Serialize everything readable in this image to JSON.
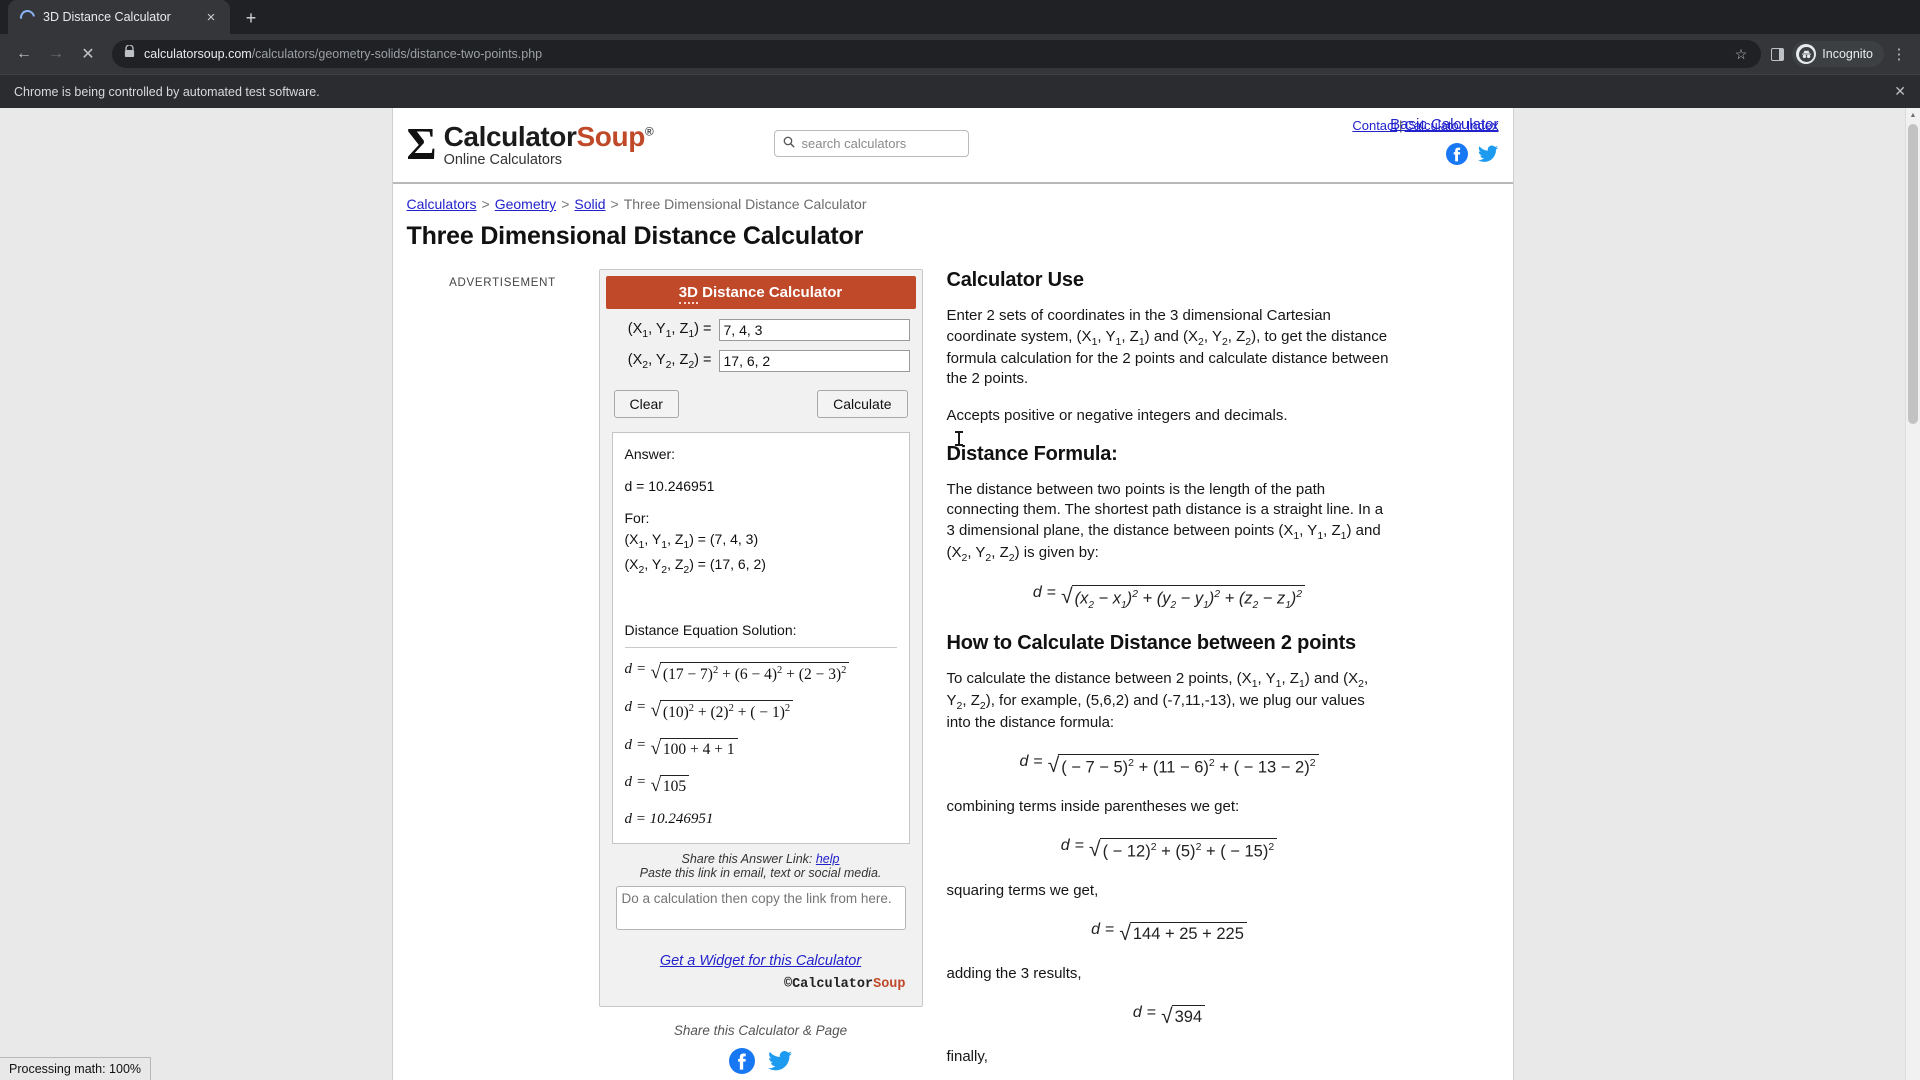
{
  "browser": {
    "tab_title": "3D Distance Calculator",
    "tab_close": "×",
    "new_tab": "+",
    "back_icon": "←",
    "forward_icon": "→",
    "stop_icon": "✕",
    "url_domain": "calculatorsoup.com",
    "url_path": "/calculators/geometry-solids/distance-two-points.php",
    "star_icon": "☆",
    "profile_label": "Incognito",
    "menu_icon": "⋮",
    "infobar_text": "Chrome is being controlled by automated test software.",
    "infobar_close": "✕"
  },
  "status": {
    "processing": "Processing math: 100%"
  },
  "site": {
    "logo_sigma": "Σ",
    "brand_first": "Calculator",
    "brand_second": "Soup",
    "brand_reg": "®",
    "tagline": "Online Calculators",
    "search_placeholder": "search calculators",
    "search_value": "",
    "top_links": {
      "contact": "Contact",
      "divider": "|",
      "index": "Calculator Index"
    },
    "social": {
      "facebook": "facebook-icon",
      "twitter": "twitter-icon"
    }
  },
  "breadcrumb": {
    "items": [
      "Calculators",
      "Geometry",
      "Solid"
    ],
    "current": "Three Dimensional Distance Calculator",
    "separator": ">"
  },
  "basic_calculator_link": "Basic Calculator",
  "page_title": "Three Dimensional Distance Calculator",
  "advertisement_label": "ADVERTISEMENT",
  "calculator": {
    "title_prefix": "3D",
    "title_rest": " Distance Calculator",
    "field1": {
      "label_open": "(X",
      "sub1": "1",
      "mid1": ", Y",
      "sub2": "1",
      "mid2": ", Z",
      "sub3": "1",
      "close": ") = ",
      "value": "7, 4, 3"
    },
    "field2": {
      "label_open": "(X",
      "sub1": "2",
      "mid1": ", Y",
      "sub2": "2",
      "mid2": ", Z",
      "sub3": "2",
      "close": ") = ",
      "value": "17, 6, 2"
    },
    "clear_label": "Clear",
    "calculate_label": "Calculate",
    "answer": {
      "heading": "Answer:",
      "result": "d = 10.246951",
      "for_label": "For:",
      "point1": "(X1, Y1, Z1) = (7, 4, 3)",
      "point2": "(X2, Y2, Z2) = (17, 6, 2)",
      "solution_heading": "Distance Equation Solution:",
      "steps": [
        "d = √((17 − 7)² + (6 − 4)² + (2 − 3)²)",
        "d = √((10)² + (2)² + ( − 1)²)",
        "d = √(100 + 4 + 1)",
        "d = √105",
        "d = 10.246951"
      ],
      "step1_radicand": "(17 − 7)² + (6 − 4)² + (2 − 3)²",
      "step2_radicand": "(10)² + (2)² + ( − 1)²",
      "step3_radicand": "100 + 4 + 1",
      "step4_radicand": "105",
      "step5_plain": "d = 10.246951"
    },
    "share": {
      "line1_text": "Share this Answer Link: ",
      "line1_link": "help",
      "line2": "Paste this link in email, text or social media.",
      "textarea_placeholder": "Do a calculation then copy the link from here.",
      "textarea_value": ""
    },
    "widget_link": "Get a Widget for this Calculator",
    "footer_c": "©",
    "footer_brand1": "Calculator",
    "footer_brand2": "Soup"
  },
  "share_page": {
    "label": "Share this Calculator & Page"
  },
  "content": {
    "h_calculator_use": "Calculator Use",
    "p1_a": "Enter 2 sets of coordinates in the 3 dimensional Cartesian coordinate system, (X",
    "p1_full": "Enter 2 sets of coordinates in the 3 dimensional Cartesian coordinate system, (X1, Y1, Z1) and (X2, Y2, Z2), to get the distance formula calculation for the 2 points and calculate distance between the 2 points.",
    "p2": "Accepts positive or negative integers and decimals.",
    "h_distance_formula": "Distance Formula:",
    "p3": "The distance between two points is the length of the path connecting them. The shortest path distance is a straight line. In a 3 dimensional plane, the distance between points (X1, Y1, Z1) and (X2, Y2, Z2) is given by:",
    "formula_main_radicand": "(x2 − x1)² + (y2 − y1)² + (z2 − z1)²",
    "h_how_to": "How to Calculate Distance between 2 points",
    "p4": "To calculate the distance between 2 points, (X1, Y1, Z1) and (X2, Y2, Z2), for example, (5,6,2) and (-7,11,-13), we plug our values into the distance formula:",
    "formula_example_radicand": "( − 7 − 5)² + (11 − 6)² + ( − 13 − 2)²",
    "p5": "combining terms inside parentheses we get:",
    "formula_combined_radicand": "( − 12)² + (5)² + ( − 15)²",
    "p6": "squaring terms we get,",
    "formula_squared_radicand": "144 + 25 + 225",
    "p7": "adding the 3 results,",
    "formula_sum_radicand": "394",
    "p8": "finally,",
    "d_var": "d",
    "equals": "="
  },
  "colors": {
    "brand_accent": "#c0492a",
    "link": "#2222cc",
    "chrome_bg": "#35363a",
    "social_blue": "#1d9bf0",
    "facebook_blue": "#1877f2"
  }
}
